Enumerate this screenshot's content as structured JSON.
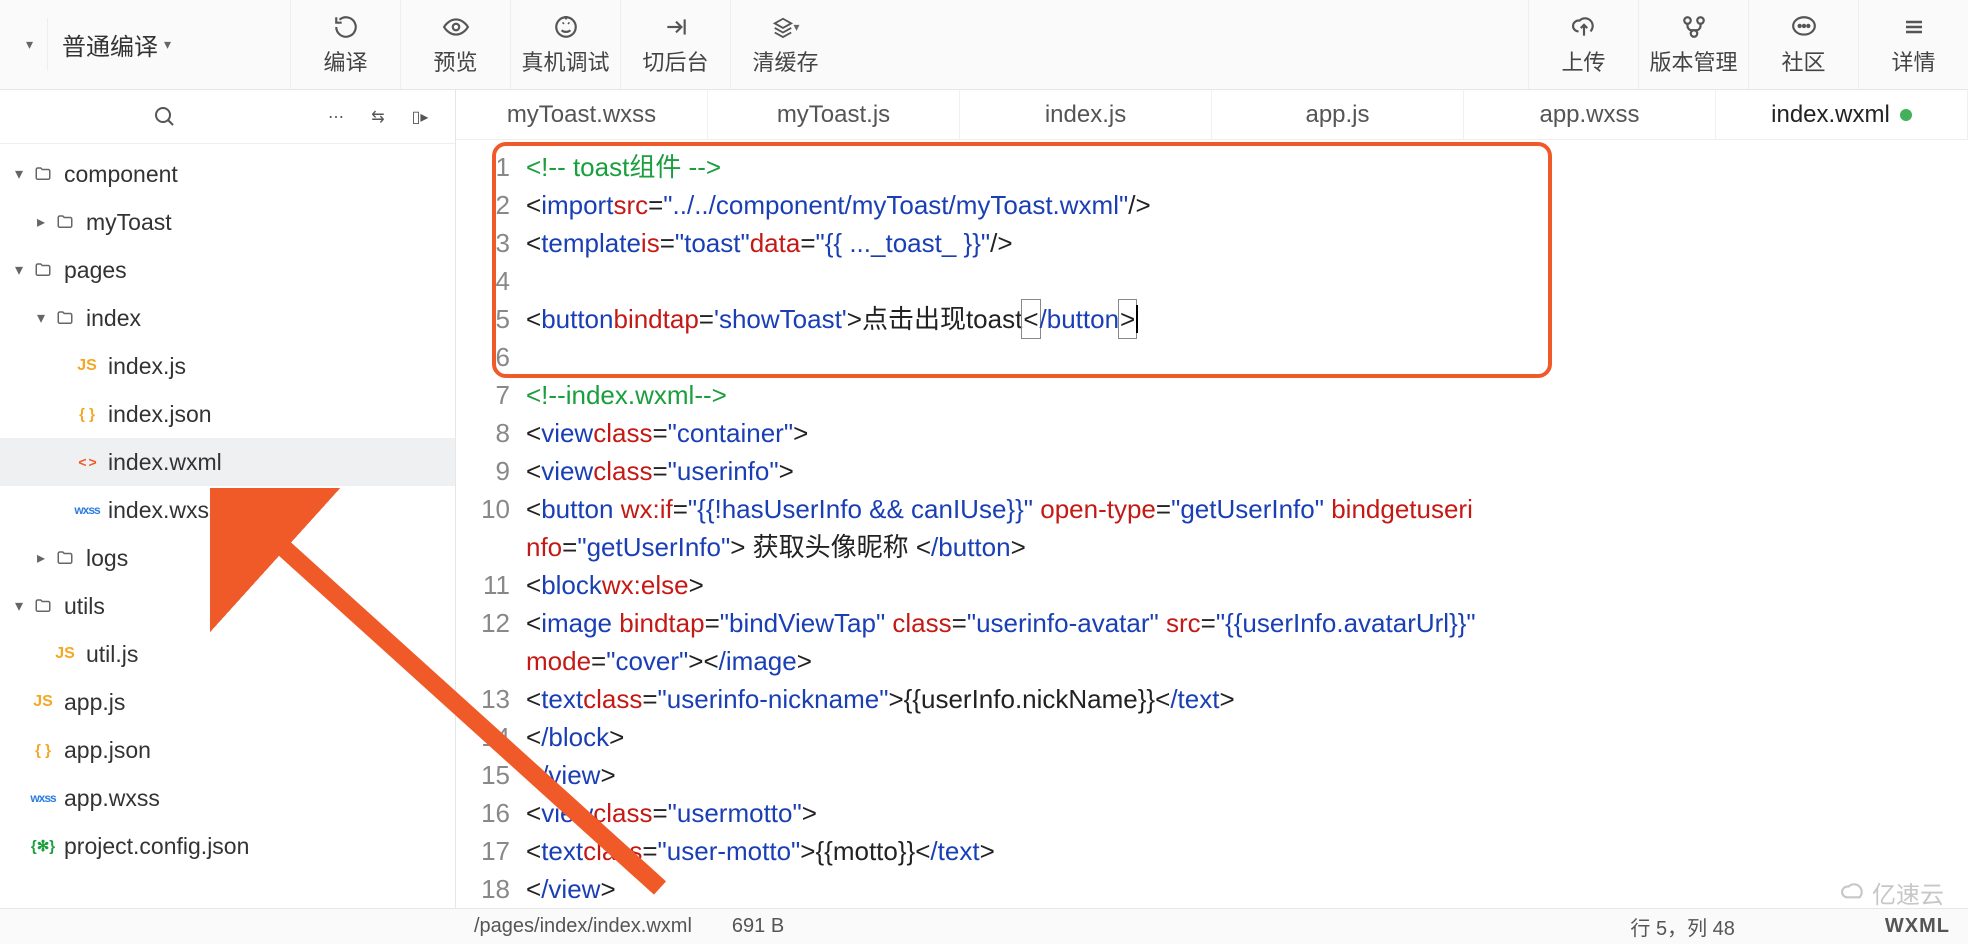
{
  "toolbar": {
    "compileMode": "普通编译",
    "buttons": [
      {
        "id": "compile",
        "label": "编译"
      },
      {
        "id": "preview",
        "label": "预览"
      },
      {
        "id": "real",
        "label": "真机调试"
      },
      {
        "id": "bg",
        "label": "切后台"
      },
      {
        "id": "clear",
        "label": "清缓存"
      }
    ],
    "rightButtons": [
      {
        "id": "upload",
        "label": "上传"
      },
      {
        "id": "vcs",
        "label": "版本管理"
      },
      {
        "id": "community",
        "label": "社区"
      },
      {
        "id": "detail",
        "label": "详情"
      }
    ]
  },
  "sidebar": {
    "items": [
      {
        "type": "folder",
        "label": "component",
        "indent": 0,
        "expanded": true
      },
      {
        "type": "folder",
        "label": "myToast",
        "indent": 1,
        "expanded": false
      },
      {
        "type": "folder",
        "label": "pages",
        "indent": 0,
        "expanded": true
      },
      {
        "type": "folder",
        "label": "index",
        "indent": 1,
        "expanded": true
      },
      {
        "type": "file",
        "label": "index.js",
        "kind": "js",
        "indent": 2
      },
      {
        "type": "file",
        "label": "index.json",
        "kind": "json",
        "indent": 2
      },
      {
        "type": "file",
        "label": "index.wxml",
        "kind": "wxml",
        "indent": 2,
        "active": true
      },
      {
        "type": "file",
        "label": "index.wxss",
        "kind": "wxss",
        "indent": 2
      },
      {
        "type": "folder",
        "label": "logs",
        "indent": 1,
        "expanded": false
      },
      {
        "type": "folder",
        "label": "utils",
        "indent": 0,
        "expanded": true
      },
      {
        "type": "file",
        "label": "util.js",
        "kind": "js",
        "indent": 1
      },
      {
        "type": "file",
        "label": "app.js",
        "kind": "js",
        "indent": 0
      },
      {
        "type": "file",
        "label": "app.json",
        "kind": "json",
        "indent": 0
      },
      {
        "type": "file",
        "label": "app.wxss",
        "kind": "wxss",
        "indent": 0
      },
      {
        "type": "file",
        "label": "project.config.json",
        "kind": "config",
        "indent": 0
      }
    ]
  },
  "tabs": [
    {
      "label": "myToast.wxss"
    },
    {
      "label": "myToast.js"
    },
    {
      "label": "index.js"
    },
    {
      "label": "app.js"
    },
    {
      "label": "app.wxss"
    },
    {
      "label": "index.wxml",
      "active": true,
      "modified": true
    }
  ],
  "code": {
    "lines": [
      {
        "n": 1,
        "html": "<span class='c-comm'>&lt;!-- toast组件 --&gt;</span>"
      },
      {
        "n": 2,
        "html": "<span class='c-punc'>&lt;</span><span class='c-tag'>import</span> <span class='c-attr'>src</span><span class='c-punc'>=</span><span class='c-str'>\"../../component/myToast/myToast.wxml\"</span><span class='c-punc'>/&gt;</span>"
      },
      {
        "n": 3,
        "html": "<span class='c-punc'>&lt;</span><span class='c-tag'>template</span> <span class='c-attr'>is</span><span class='c-punc'>=</span><span class='c-str'>\"toast\"</span> <span class='c-attr'>data</span><span class='c-punc'>=</span><span class='c-str'>\"{{ ..._toast_ }}\"</span><span class='c-punc'>/&gt;</span>"
      },
      {
        "n": 4,
        "html": ""
      },
      {
        "n": 5,
        "html": "<span class='c-punc'>&lt;</span><span class='c-tag'>button</span> <span class='c-attr'>bindtap</span><span class='c-punc'>=</span><span class='c-str'>'showToast'</span><span class='c-punc'>&gt;</span><span class='c-text'>点击出现toast</span><span class='box-ch c-punc'>&lt;</span><span class='c-tag'>/button</span><span class='box-ch c-punc'>&gt;</span><span class='caret-blink'></span>"
      },
      {
        "n": 6,
        "html": ""
      },
      {
        "n": 7,
        "html": "<span class='c-comm'>&lt;!--index.wxml--&gt;</span>"
      },
      {
        "n": 8,
        "html": "<span class='c-punc'>&lt;</span><span class='c-tag'>view</span> <span class='c-attr'>class</span><span class='c-punc'>=</span><span class='c-str'>\"container\"</span><span class='c-punc'>&gt;</span>"
      },
      {
        "n": 9,
        "html": "  <span class='c-punc'>&lt;</span><span class='c-tag'>view</span> <span class='c-attr'>class</span><span class='c-punc'>=</span><span class='c-str'>\"userinfo\"</span><span class='c-punc'>&gt;</span>"
      },
      {
        "n": 10,
        "html": "    <span class='c-punc'>&lt;</span><span class='c-tag'>button</span> <span class='c-attr'>wx:if</span><span class='c-punc'>=</span><span class='c-str'>\"{{!hasUserInfo &amp;&amp; canIUse}}\"</span> <span class='c-attr'>open-type</span><span class='c-punc'>=</span><span class='c-str'>\"getUserInfo\"</span> <span class='c-attr'>bindgetuserinfo</span><span class='c-punc'>=</span><span class='c-str'>\"getUserInfo\"</span><span class='c-punc'>&gt;</span><span class='c-text'> 获取头像昵称 </span><span class='c-punc'>&lt;</span><span class='c-tag'>/button</span><span class='c-punc'>&gt;</span>",
        "wrap": true
      },
      {
        "n": 11,
        "html": "    <span class='c-punc'>&lt;</span><span class='c-tag'>block</span> <span class='c-attr'>wx:else</span><span class='c-punc'>&gt;</span>"
      },
      {
        "n": 12,
        "html": "      <span class='c-punc'>&lt;</span><span class='c-tag'>image</span> <span class='c-attr'>bindtap</span><span class='c-punc'>=</span><span class='c-str'>\"bindViewTap\"</span> <span class='c-attr'>class</span><span class='c-punc'>=</span><span class='c-str'>\"userinfo-avatar\"</span> <span class='c-attr'>src</span><span class='c-punc'>=</span><span class='c-str'>\"{{userInfo.avatarUrl}}\"</span> <span class='c-attr'>mode</span><span class='c-punc'>=</span><span class='c-str'>\"cover\"</span><span class='c-punc'>&gt;&lt;</span><span class='c-tag'>/image</span><span class='c-punc'>&gt;</span>",
        "wrap": true
      },
      {
        "n": 13,
        "html": "      <span class='c-punc'>&lt;</span><span class='c-tag'>text</span> <span class='c-attr'>class</span><span class='c-punc'>=</span><span class='c-str'>\"userinfo-nickname\"</span><span class='c-punc'>&gt;</span><span class='c-text'>{{userInfo.nickName}}</span><span class='c-punc'>&lt;</span><span class='c-tag'>/text</span><span class='c-punc'>&gt;</span>"
      },
      {
        "n": 14,
        "html": "    <span class='c-punc'>&lt;</span><span class='c-tag'>/block</span><span class='c-punc'>&gt;</span>"
      },
      {
        "n": 15,
        "html": "  <span class='c-punc'>&lt;</span><span class='c-tag'>/view</span><span class='c-punc'>&gt;</span>"
      },
      {
        "n": 16,
        "html": "  <span class='c-punc'>&lt;</span><span class='c-tag'>view</span> <span class='c-attr'>class</span><span class='c-punc'>=</span><span class='c-str'>\"usermotto\"</span><span class='c-punc'>&gt;</span>"
      },
      {
        "n": 17,
        "html": "    <span class='c-punc'>&lt;</span><span class='c-tag'>text</span> <span class='c-attr'>class</span><span class='c-punc'>=</span><span class='c-str'>\"user-motto\"</span><span class='c-punc'>&gt;</span><span class='c-text'>{{motto}}</span><span class='c-punc'>&lt;</span><span class='c-tag'>/text</span><span class='c-punc'>&gt;</span>"
      },
      {
        "n": 18,
        "html": "  <span class='c-punc'>&lt;</span><span class='c-tag'>/view</span><span class='c-punc'>&gt;</span>"
      }
    ]
  },
  "status": {
    "path": "/pages/index/index.wxml",
    "size": "691 B",
    "pos": "行 5，列 48",
    "lang": "WXML"
  },
  "watermark": "亿速云"
}
